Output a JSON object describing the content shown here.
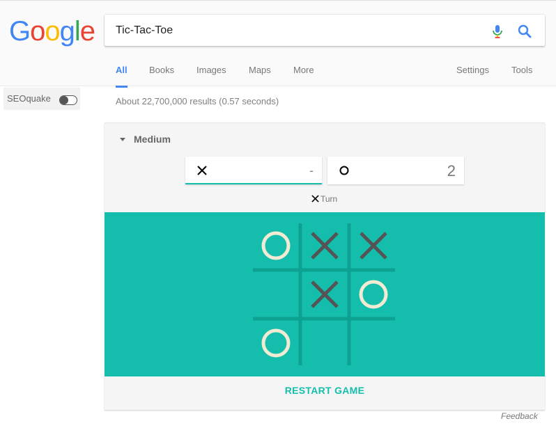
{
  "logo": {
    "letters": [
      "G",
      "o",
      "o",
      "g",
      "l",
      "e"
    ],
    "colors": [
      "#4285f4",
      "#ea4335",
      "#fbbc05",
      "#4285f4",
      "#34a853",
      "#ea4335"
    ]
  },
  "search": {
    "value": "Tic-Tac-Toe"
  },
  "icons": {
    "mic": "microphone-icon",
    "search": "search-icon"
  },
  "tabs": [
    {
      "label": "All",
      "active": true
    },
    {
      "label": "Books"
    },
    {
      "label": "Images"
    },
    {
      "label": "Maps"
    },
    {
      "label": "More"
    }
  ],
  "tools": {
    "settings": "Settings",
    "tools": "Tools"
  },
  "seoquake": {
    "label": "SEOquake",
    "enabled": false
  },
  "result_stats": "About 22,700,000 results (0.57 seconds)",
  "game": {
    "difficulty": "Medium",
    "players": {
      "x": {
        "symbol": "X",
        "score": "-"
      },
      "o": {
        "symbol": "O",
        "score": "2"
      }
    },
    "turn_label": "Turn",
    "turn_symbol": "X",
    "board": [
      [
        "O",
        "X",
        "X"
      ],
      [
        "",
        "X",
        "O"
      ],
      [
        "O",
        "",
        ""
      ]
    ],
    "colors": {
      "board": "#14bdac",
      "grid": "#0da192",
      "x": "#545454",
      "o": "#f2ebd3"
    },
    "restart_label": "RESTART GAME"
  },
  "feedback": "Feedback"
}
